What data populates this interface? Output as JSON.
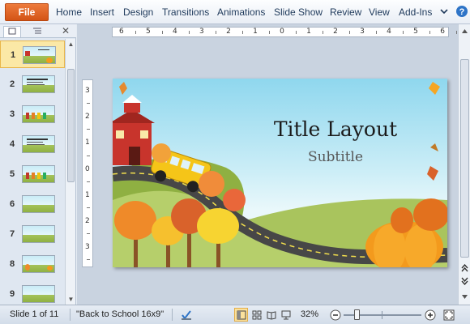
{
  "ribbon": {
    "file_label": "File",
    "tabs": [
      "Home",
      "Insert",
      "Design",
      "Transitions",
      "Animations",
      "Slide Show",
      "Review",
      "View",
      "Add-Ins"
    ]
  },
  "icons": {
    "collapse_ribbon": "chevron-down-icon",
    "help": "help-icon"
  },
  "slides_panel": {
    "close_label": "✕",
    "slide_numbers": [
      "1",
      "2",
      "3",
      "4",
      "5",
      "6",
      "7",
      "8",
      "9"
    ],
    "selected_index": 0
  },
  "ruler": {
    "horizontal_labels": [
      "6",
      "5",
      "4",
      "3",
      "2",
      "1",
      "0",
      "1",
      "2",
      "3",
      "4",
      "5",
      "6"
    ],
    "vertical_labels": [
      "3",
      "2",
      "1",
      "0",
      "1",
      "2",
      "3"
    ]
  },
  "slide": {
    "title": "Title Layout",
    "subtitle": "Subtitle"
  },
  "status": {
    "slide_indicator": "Slide 1 of 11",
    "theme_name": "\"Back to School 16x9\"",
    "zoom_level": "32%",
    "zoom_fraction": 0.32
  },
  "colors": {
    "file_tab": "#d35416",
    "selected_thumb": "#fbe8a6",
    "sky": "#8fd7ee",
    "grass": "#a4c35a"
  }
}
